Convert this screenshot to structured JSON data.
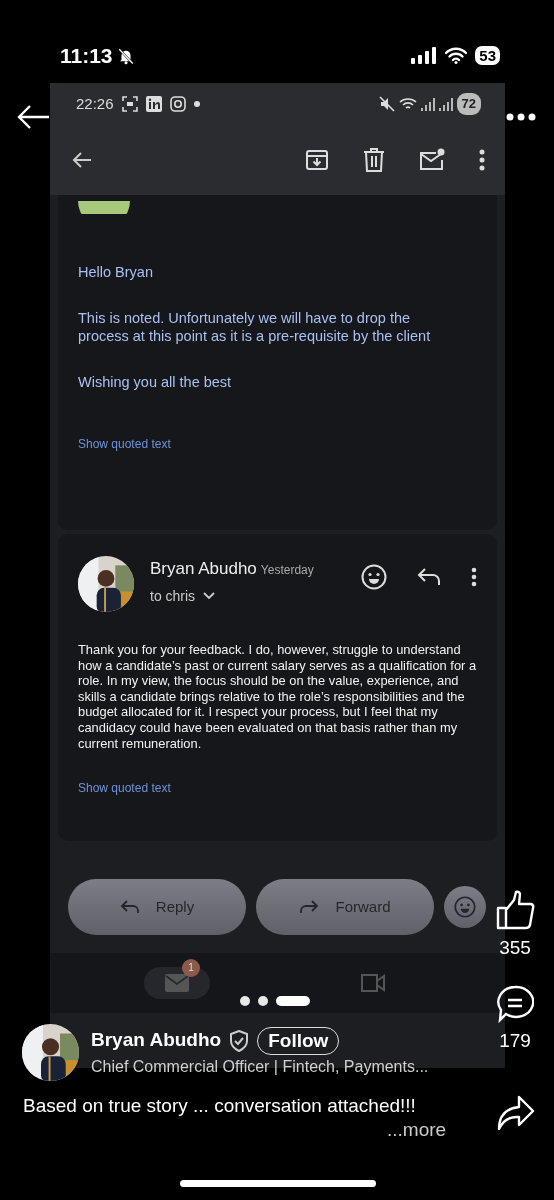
{
  "phone_status": {
    "time": "11:13",
    "battery": "53"
  },
  "screenshot": {
    "status_bar": {
      "time": "22:26",
      "battery": "72"
    },
    "messages": [
      {
        "kind": "received",
        "paragraphs": [
          "Hello Bryan",
          "This is noted. Unfortunately we will have to drop the process at this point as it is a pre-requisite by the client",
          "Wishing you all the best"
        ],
        "quoted_link": "Show quoted text"
      },
      {
        "kind": "sent",
        "sender": "Bryan Abudho",
        "time": "Yesterday",
        "recipient": "to chris",
        "body": "Thank you for your feedback. I do, however, struggle to understand how a candidate’s past or current salary serves as a qualification for a role. In my view, the focus should be on the value, experience, and skills a candidate brings relative to the role’s responsibilities and the budget allocated for it. I respect your process, but I feel that my candidacy could have been evaluated on that basis rather than my current remuneration.",
        "quoted_link": "Show quoted text"
      }
    ],
    "actions": [
      {
        "kind": "reply",
        "label": "Reply"
      },
      {
        "kind": "forward",
        "label": "Forward"
      }
    ],
    "nav": [
      {
        "kind": "mail",
        "badge": "1",
        "selected": true
      },
      {
        "kind": "video",
        "selected": false
      }
    ]
  },
  "carousel": [
    {
      "selected": false
    },
    {
      "selected": false
    },
    {
      "selected": true
    }
  ],
  "reactions": {
    "likes": "355",
    "comments": "179"
  },
  "author": {
    "name": "Bryan Abudho",
    "headline": "Chief Commercial Officer | Fintech, Payments...",
    "follow": "Follow"
  },
  "caption": "Based on true story ... conversation attached!!!",
  "more": "...more"
}
